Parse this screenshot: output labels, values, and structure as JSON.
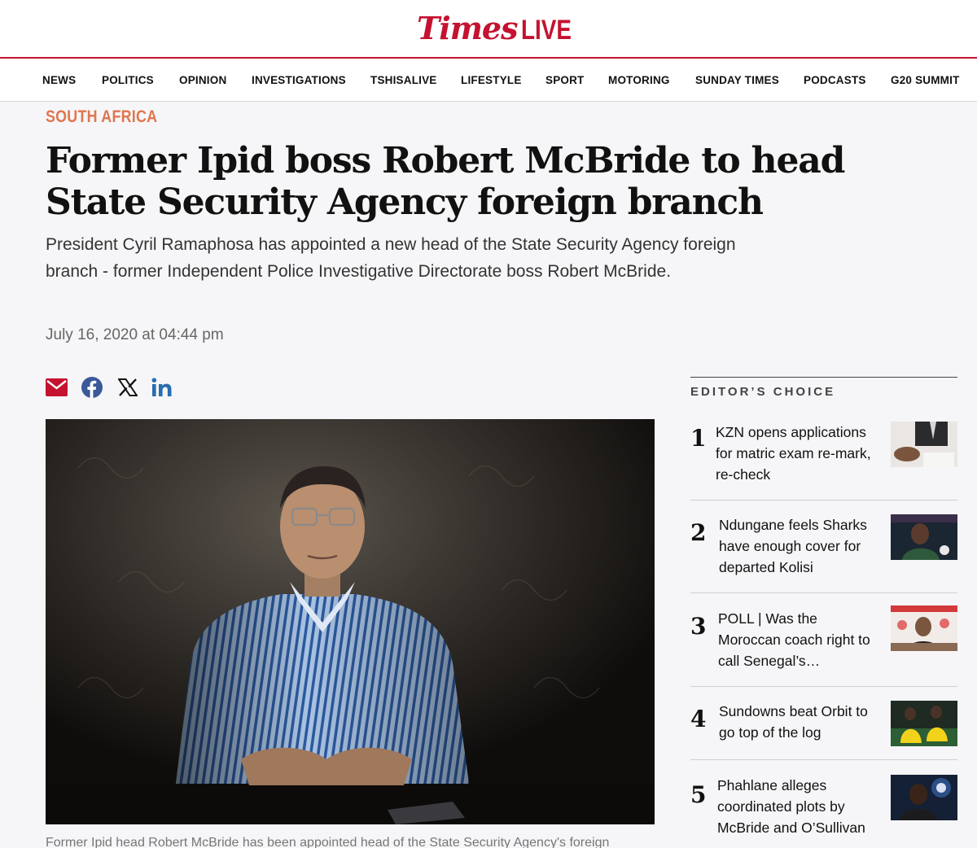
{
  "header": {
    "logo_times": "Times",
    "logo_live": "LIVE"
  },
  "nav": {
    "items": [
      "NEWS",
      "POLITICS",
      "OPINION",
      "INVESTIGATIONS",
      "TSHISALIVE",
      "LIFESTYLE",
      "SPORT",
      "MOTORING",
      "SUNDAY TIMES",
      "PODCASTS",
      "G20 SUMMIT"
    ]
  },
  "article": {
    "section": "SOUTH AFRICA",
    "headline": "Former Ipid boss Robert McBride to head State Security Agency foreign branch",
    "standfirst": "President Cyril Ramaphosa has appointed a new head of the State Security Agency foreign branch - former Independent Police Investigative Directorate boss Robert McBride.",
    "date": "July 16, 2020 at 04:44 pm",
    "caption": "Former Ipid head Robert McBride has been appointed head of the State Security Agency's foreign"
  },
  "share": {
    "icons": [
      "email-icon",
      "facebook-icon",
      "x-icon",
      "linkedin-icon"
    ],
    "email_color": "#c41230",
    "facebook_color": "#3b5998",
    "x_color": "#111111",
    "linkedin_color": "#2a6ead"
  },
  "editors_choice": {
    "title": "EDITOR’S CHOICE",
    "items": [
      {
        "num": "1",
        "title": "KZN opens applications for matric exam re-mark, re-check"
      },
      {
        "num": "2",
        "title": "Ndungane feels Sharks have enough cover for departed Kolisi"
      },
      {
        "num": "3",
        "title": "POLL | Was the Moroccan coach right to call Senegal’s…"
      },
      {
        "num": "4",
        "title": "Sundowns beat Orbit to go top of the log"
      },
      {
        "num": "5",
        "title": "Phahlane alleges coordinated plots by McBride and O’Sullivan"
      }
    ]
  },
  "colors": {
    "brand": "#c41230",
    "section": "#e0764f"
  }
}
